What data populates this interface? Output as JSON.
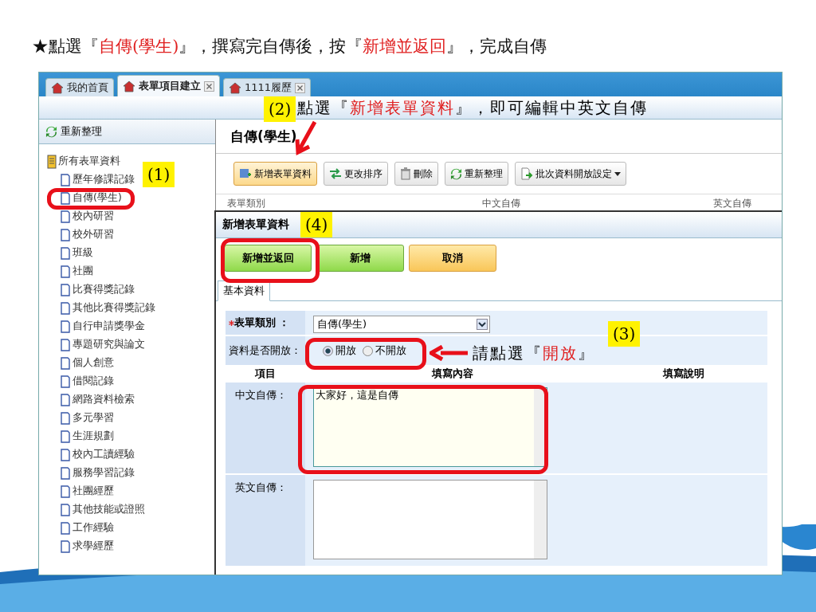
{
  "instruction": [
    {
      "text": "★點選『",
      "highlight": false
    },
    {
      "text": "自傳(學生)",
      "highlight": true
    },
    {
      "text": "』，撰寫完自傳後，按『",
      "highlight": false
    },
    {
      "text": "新增並返回",
      "highlight": true
    },
    {
      "text": "』，完成自傳",
      "highlight": false
    }
  ],
  "tabs": [
    {
      "label": "我的首頁",
      "selected": false,
      "closable": false
    },
    {
      "label": "表單項目建立",
      "selected": true,
      "closable": true
    },
    {
      "label": "1111履歷",
      "selected": false,
      "closable": true
    }
  ],
  "callouts": [
    {
      "number": "(1)"
    },
    {
      "number": "(2)",
      "text": [
        {
          "text": "點選『",
          "highlight": false
        },
        {
          "text": "新增表單資料",
          "highlight": true
        },
        {
          "text": "』，即可編輯中英文自傳",
          "highlight": false
        }
      ]
    },
    {
      "number": "(3)",
      "text": [
        {
          "text": "請點選『",
          "highlight": false
        },
        {
          "text": "開放",
          "highlight": true
        },
        {
          "text": "』",
          "highlight": false
        }
      ]
    },
    {
      "number": "(4)"
    }
  ],
  "sidebar": {
    "refresh": "重新整理",
    "tree": {
      "label": "所有表單資料",
      "children": [
        {
          "label": "歷年修課記錄"
        },
        {
          "label": "自傳(學生)"
        },
        {
          "label": "校內研習"
        },
        {
          "label": "校外研習"
        },
        {
          "label": "班級"
        },
        {
          "label": "社團"
        },
        {
          "label": "比賽得獎記錄"
        },
        {
          "label": "其他比賽得獎記錄"
        },
        {
          "label": "自行申請獎學金"
        },
        {
          "label": "專題研究與論文"
        },
        {
          "label": "個人創意"
        },
        {
          "label": "借閱記錄"
        },
        {
          "label": "網路資料檢索"
        },
        {
          "label": "多元學習"
        },
        {
          "label": "生涯規劃"
        },
        {
          "label": "校內工讀經驗"
        },
        {
          "label": "服務學習記錄"
        },
        {
          "label": "社團經歷"
        },
        {
          "label": "其他技能或證照"
        },
        {
          "label": "工作經驗"
        },
        {
          "label": "求學經歷"
        }
      ]
    }
  },
  "content": {
    "title": "自傳(學生)",
    "toolbar": [
      {
        "label": "新增表單資料",
        "highlighted": true,
        "kind": "button"
      },
      {
        "label": "更改排序",
        "highlighted": false,
        "kind": "button"
      },
      {
        "label": "刪除",
        "highlighted": false,
        "kind": "button"
      },
      {
        "label": "重新整理",
        "highlighted": false,
        "kind": "button"
      },
      {
        "label": "批次資料開放設定",
        "highlighted": false,
        "kind": "dropdown"
      }
    ],
    "table_columns": [
      "表單類別",
      "中文自傳",
      "英文自傳"
    ]
  },
  "dialog": {
    "title": "新增表單資料",
    "buttons": [
      {
        "label": "新增並返回",
        "kind": "confirm"
      },
      {
        "label": "新增",
        "kind": "confirm"
      },
      {
        "label": "取消",
        "kind": "cancel"
      }
    ],
    "tabs": [
      {
        "label": "基本資料",
        "selected": true
      }
    ],
    "category": {
      "label": "表單類別 ：",
      "required": true,
      "value": "自傳(學生)"
    },
    "open": {
      "label": "資料是否開放：",
      "options": [
        {
          "label": "開放",
          "selected": true
        },
        {
          "label": "不開放",
          "selected": false
        }
      ]
    },
    "columns": [
      "項目",
      "填寫內容",
      "填寫說明"
    ],
    "fields": [
      {
        "label": "中文自傳：",
        "value": "大家好，這是自傳",
        "focused": true
      },
      {
        "label": "英文自傳：",
        "focused": false
      }
    ]
  }
}
